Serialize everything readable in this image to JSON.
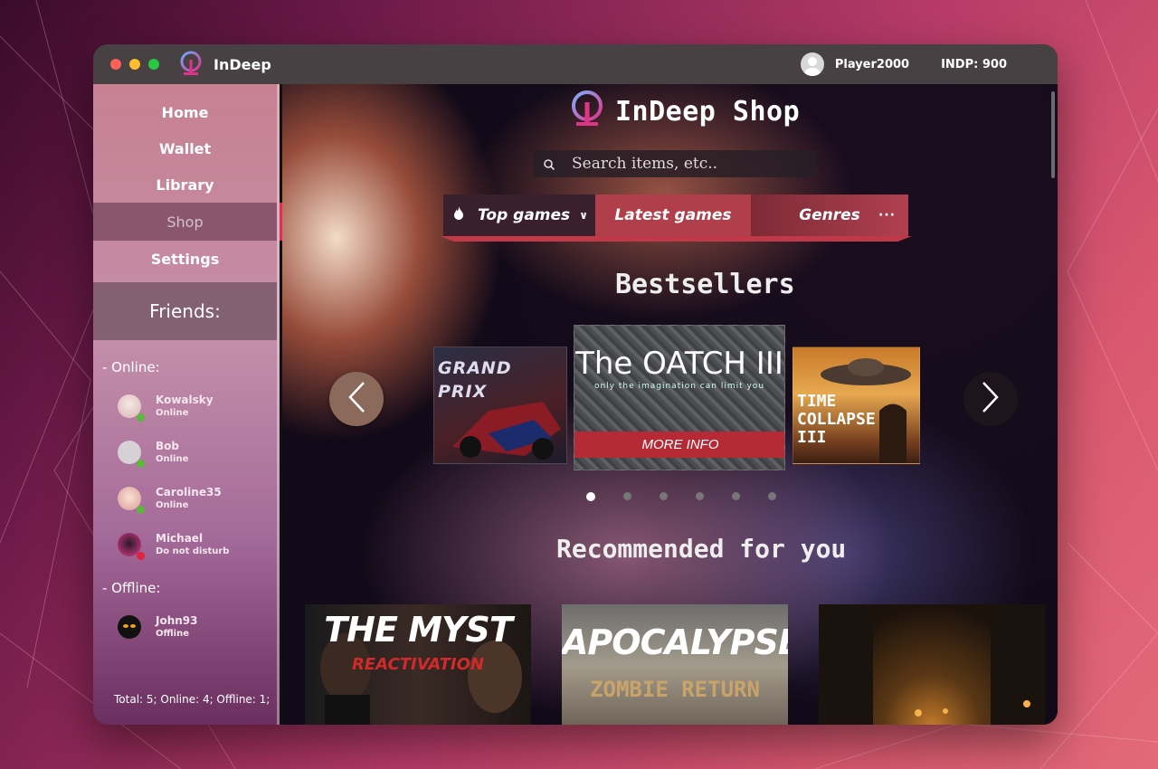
{
  "app": {
    "name": "InDeep"
  },
  "user": {
    "name": "Player2000",
    "balance": "INDP: 900"
  },
  "nav": [
    {
      "label": "Home"
    },
    {
      "label": "Wallet"
    },
    {
      "label": "Library"
    },
    {
      "label": "Shop"
    },
    {
      "label": "Settings"
    }
  ],
  "friends": {
    "title": "Friends:",
    "online_label": "- Online:",
    "offline_label": "- Offline:",
    "online": [
      {
        "name": "Kowalsky",
        "status": "Online",
        "dot_color": "#5ab83a"
      },
      {
        "name": "Bob",
        "status": "Online",
        "dot_color": "#5ab83a"
      },
      {
        "name": "Caroline35",
        "status": "Online",
        "dot_color": "#5ab83a"
      },
      {
        "name": "Michael",
        "status": "Do not disturb",
        "dot_color": "#e0233b"
      }
    ],
    "offline": [
      {
        "name": "John93",
        "status": "Offline"
      }
    ],
    "total": "Total: 5; Online: 4; Offline: 1;"
  },
  "shop": {
    "title": "InDeep Shop",
    "search_placeholder": "Search items, etc..",
    "tabs": {
      "top": "Top games",
      "latest": "Latest games",
      "genres": "Genres"
    },
    "bestsellers_title": "Bestsellers",
    "bestsellers": [
      {
        "title": "GRAND PRIX"
      },
      {
        "title": "The OATCH III",
        "tagline": "only the imagination can limit you",
        "cta": "MORE INFO"
      },
      {
        "title": "TIME COLLAPSE III"
      }
    ],
    "carousel_pages": 6,
    "carousel_active": 1,
    "recommended_title": "Recommended for you",
    "recommended": [
      {
        "title": "THE MYST",
        "subtitle": "REACTIVATION"
      },
      {
        "title": "APOCALYPSE",
        "subtitle": "ZOMBIE RETURN"
      },
      {
        "title": ""
      }
    ]
  },
  "colors": {
    "accent": "#e52b4f",
    "tab_active": "#b03e4b"
  }
}
